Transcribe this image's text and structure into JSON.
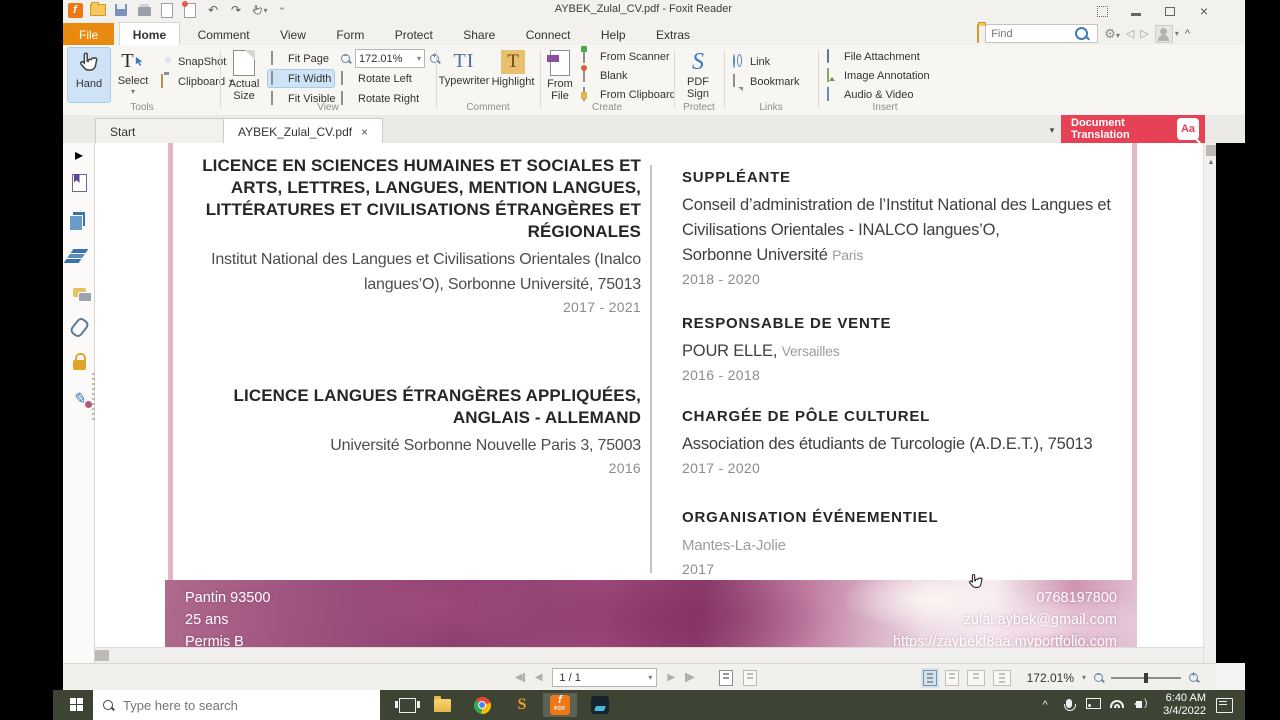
{
  "titlebar": {
    "title": "AYBEK_Zulal_CV.pdf - Foxit Reader"
  },
  "menu": {
    "items": [
      "File",
      "Home",
      "Comment",
      "View",
      "Form",
      "Protect",
      "Share",
      "Connect",
      "Help",
      "Extras"
    ]
  },
  "find": {
    "placeholder": "Find"
  },
  "glyphs": {
    "dropdown": "▾",
    "collapse": "^",
    "back": "◁",
    "forward": "▷",
    "prev": "◀",
    "next": "▶",
    "undo": "↶",
    "redo": "↷",
    "close_tab": "×",
    "expand_sidebar": "▸",
    "scroll_up": "▲",
    "minus": "−",
    "plus": "+",
    "typewriter": "TI",
    "highlight": "T",
    "pdf_sign": "S",
    "aa": "Aa",
    "foxit": "f",
    "pdf_small": "PDF",
    "sublime": "S"
  },
  "ribbon": {
    "tools": {
      "label": "Tools",
      "hand": "Hand",
      "select": "Select",
      "snapshot": "SnapShot",
      "clipboard": "Clipboard"
    },
    "view": {
      "label": "View",
      "actual_size": "Actual Size",
      "fit_page": "Fit Page",
      "fit_width": "Fit Width",
      "fit_visible": "Fit Visible",
      "rotate_left": "Rotate Left",
      "rotate_right": "Rotate Right",
      "zoom": "172.01%"
    },
    "comment": {
      "label": "Comment",
      "typewriter": "Typewriter",
      "highlight": "Highlight"
    },
    "create": {
      "label": "Create",
      "from_file": "From File",
      "from_scanner": "From Scanner",
      "blank": "Blank",
      "from_clipboard": "From Clipboard"
    },
    "protect": {
      "label": "Protect",
      "pdf_sign": "PDF Sign"
    },
    "links": {
      "label": "Links",
      "link": "Link",
      "bookmark": "Bookmark"
    },
    "insert": {
      "label": "Insert",
      "file_attachment": "File Attachment",
      "image_annotation": "Image Annotation",
      "audio_video": "Audio & Video"
    }
  },
  "doc_tabs": {
    "start": "Start",
    "file": "AYBEK_Zulal_CV.pdf"
  },
  "translation": {
    "line1": "Document",
    "line2": "Translation"
  },
  "cv": {
    "left": [
      {
        "title": "LICENCE EN SCIENCES HUMAINES ET SOCIALES ET ARTS, LETTRES, LANGUES, MENTION LANGUES, LITTÉRATURES ET CIVILISATIONS ÉTRANGÈRES ET RÉGIONALES",
        "org": "Institut National des Langues et Civilisations Orientales (Inalco langues’O), Sorbonne Université, 75013",
        "date": "2017 - 2021"
      },
      {
        "title": "LICENCE LANGUES ÉTRANGÈRES APPLIQUÉES, ANGLAIS - ALLEMAND",
        "org": "Université Sorbonne Nouvelle Paris 3, 75003",
        "date": "2016"
      }
    ],
    "right": [
      {
        "title": "SUPPLÉANTE",
        "org": "Conseil d’administration de l’Institut National des Langues et Civilisations Orientales - INALCO langues’O,",
        "org2": "Sorbonne Université",
        "place": "Paris",
        "date": "2018 - 2020"
      },
      {
        "title": "RESPONSABLE DE VENTE",
        "org": "POUR ELLE,",
        "place": "Versailles",
        "date": "2016 - 2018"
      },
      {
        "title": "CHARGÉE DE PÔLE CULTUREL",
        "org": "Association des étudiants de Turcologie (A.D.E.T.), 75013",
        "date": "2017 - 2020"
      },
      {
        "title": "ORGANISATION ÉVÉNEMENTIEL",
        "place": "Mantes-La-Jolie",
        "date": "2017"
      }
    ],
    "banner": {
      "left": [
        "Pantin 93500",
        "25 ans",
        "Permis B"
      ],
      "right": [
        "0768197800",
        "zulal.aybek@gmail.com",
        "https://zaybekf8aa.myportfolio.com"
      ]
    }
  },
  "statusbar": {
    "page": "1 / 1",
    "zoom": "172.01%"
  },
  "taskbar": {
    "search_placeholder": "Type here to search",
    "time": "6:40 AM",
    "date": "3/4/2022"
  },
  "colors": {
    "accent_orange": "#e9890f",
    "selection_blue": "#cfe3f6",
    "translation_red": "#e64155",
    "taskbar_olive": "#3d4434"
  }
}
